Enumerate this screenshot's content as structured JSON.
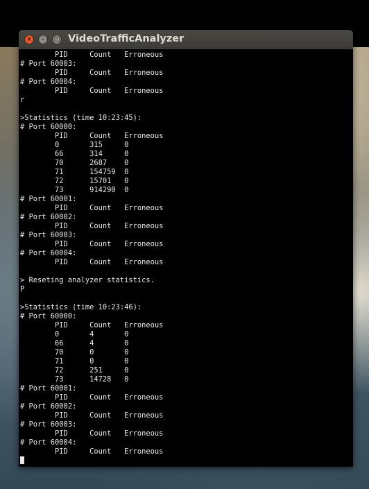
{
  "window": {
    "title": "VideoTrafficAnalyzer",
    "close_icon": "×",
    "minimize_icon": "–",
    "maximize_icon": "□"
  },
  "terminal": {
    "lines": [
      "        PID     Count   Erroneous",
      "# Port 60003:",
      "        PID     Count   Erroneous",
      "# Port 60004:",
      "        PID     Count   Erroneous",
      "r",
      "",
      ">Statistics (time 10:23:45):",
      "# Port 60000:",
      "        PID     Count   Erroneous",
      "        0       315     0",
      "        66      314     0",
      "        70      2687    0",
      "        71      154759  0",
      "        72      15701   0",
      "        73      914290  0",
      "# Port 60001:",
      "        PID     Count   Erroneous",
      "# Port 60002:",
      "        PID     Count   Erroneous",
      "# Port 60003:",
      "        PID     Count   Erroneous",
      "# Port 60004:",
      "        PID     Count   Erroneous",
      "",
      "> Reseting analyzer statistics.",
      "P",
      "",
      ">Statistics (time 10:23:46):",
      "# Port 60000:",
      "        PID     Count   Erroneous",
      "        0       4       0",
      "        66      4       0",
      "        70      0       0",
      "        71      0       0",
      "        72      251     0",
      "        73      14728   0",
      "# Port 60001:",
      "        PID     Count   Erroneous",
      "# Port 60002:",
      "        PID     Count   Erroneous",
      "# Port 60003:",
      "        PID     Count   Erroneous",
      "# Port 60004:",
      "        PID     Count   Erroneous"
    ]
  }
}
